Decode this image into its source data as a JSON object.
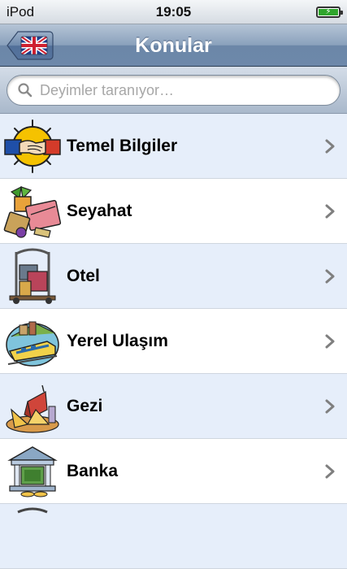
{
  "status_bar": {
    "carrier": "iPod",
    "time": "19:05",
    "battery_level": 1.0
  },
  "nav": {
    "title": "Konular",
    "back_icon": "uk-flag-icon"
  },
  "search": {
    "placeholder": "Deyimler taranıyor…",
    "value": ""
  },
  "topics": [
    {
      "label": "Temel Bilgiler",
      "icon": "handshake-icon"
    },
    {
      "label": "Seyahat",
      "icon": "travel-luggage-icon"
    },
    {
      "label": "Otel",
      "icon": "hotel-luggage-cart-icon"
    },
    {
      "label": "Yerel Ulaşım",
      "icon": "local-transport-train-icon"
    },
    {
      "label": "Gezi",
      "icon": "sightseeing-landmarks-icon"
    },
    {
      "label": "Banka",
      "icon": "bank-building-icon"
    }
  ],
  "colors": {
    "row_alt": "#e6eefa",
    "row_white": "#ffffff",
    "nav_bar": "#6d88aa",
    "battery_green": "#2fa52c"
  }
}
